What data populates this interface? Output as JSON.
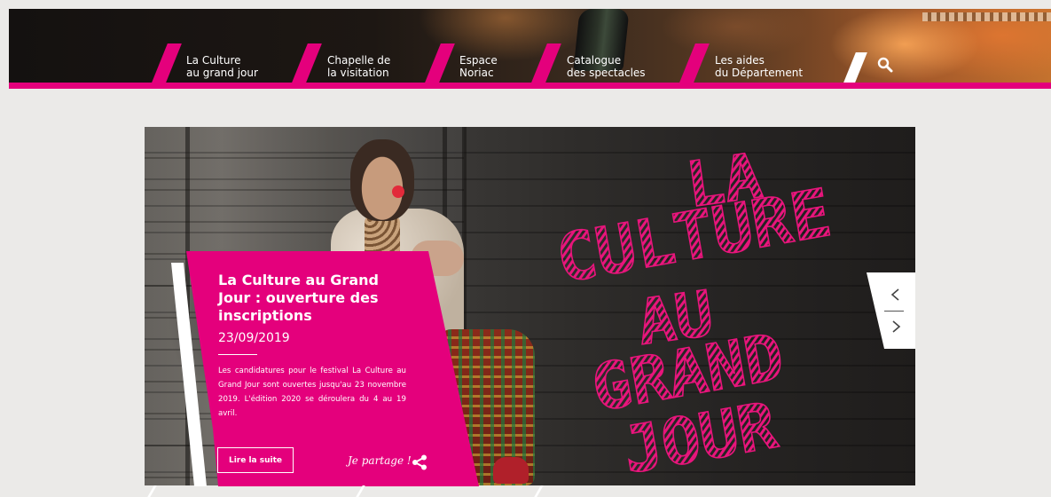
{
  "nav": {
    "items": [
      {
        "label_1": "La Culture",
        "label_2": "au grand jour"
      },
      {
        "label_1": "Chapelle de",
        "label_2": "la visitation"
      },
      {
        "label_1": "Espace",
        "label_2": "Noriac"
      },
      {
        "label_1": "Catalogue",
        "label_2": "des spectacles"
      },
      {
        "label_1": "Les aides",
        "label_2": "du Département"
      }
    ],
    "search_icon": "search-icon"
  },
  "hero": {
    "art_words": [
      "LA",
      "CULTURE",
      "AU",
      "GRAND",
      "JOUR"
    ],
    "card": {
      "title": "La Culture au Grand Jour : ouverture des inscriptions",
      "date": "23/09/2019",
      "text": "Les candidatures pour le festival La Culture au Grand Jour sont ouvertes jusqu'au 23 novembre 2019. L'édition 2020 se déroulera du 4 au 19 avril.",
      "button": "Lire la suite",
      "share_label": "Je partage !",
      "share_icon": "share-icon"
    },
    "carousel": {
      "prev_icon": "chevron-left-icon",
      "next_icon": "chevron-right-icon"
    }
  },
  "colors": {
    "accent": "#e4007c",
    "background": "#ebeae8"
  }
}
